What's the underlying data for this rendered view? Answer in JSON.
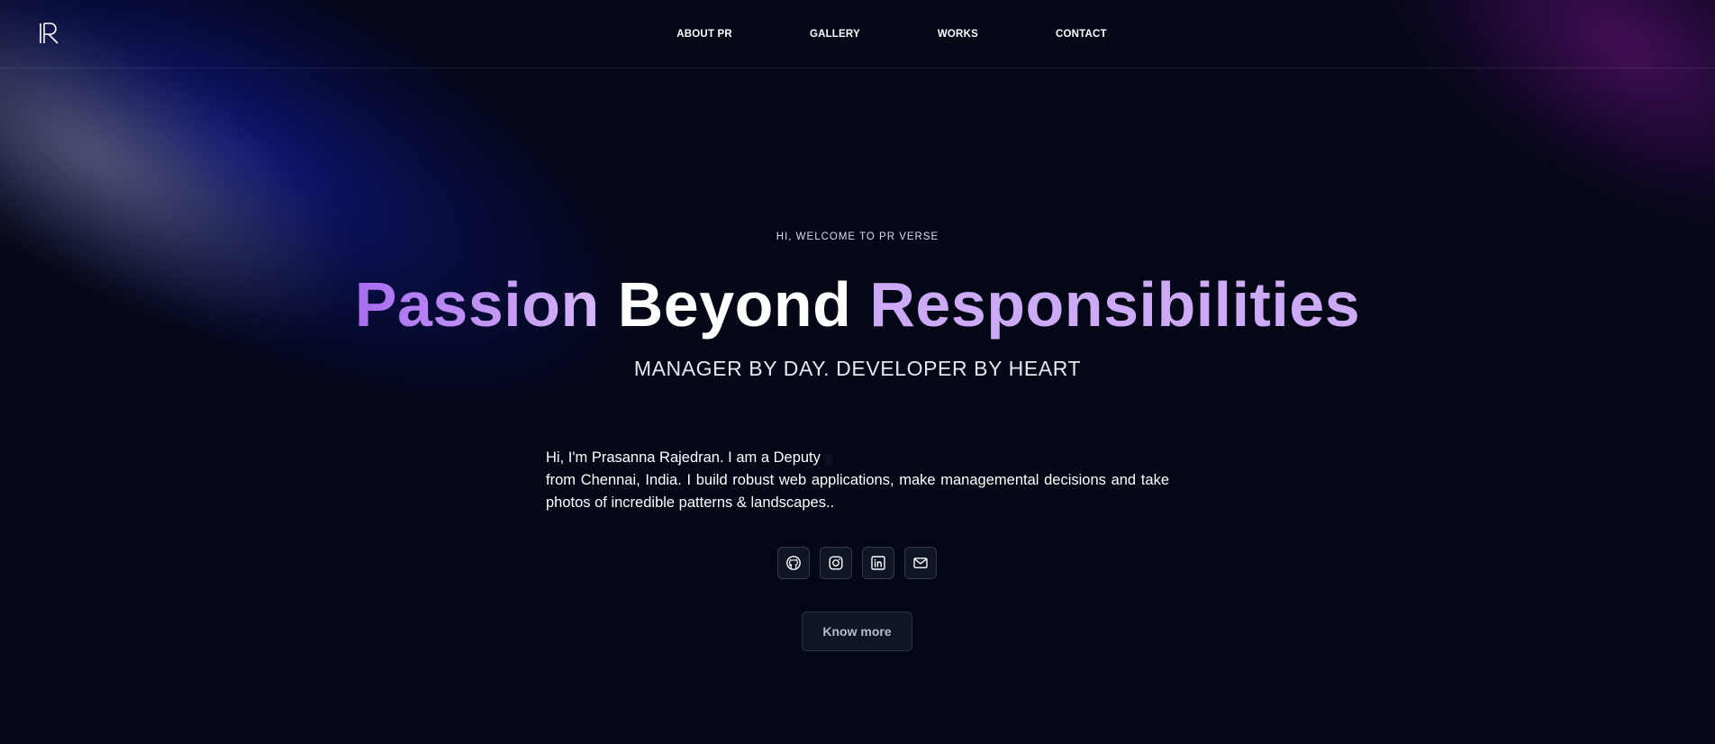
{
  "nav": {
    "logo_alt": "PR",
    "links": [
      "ABOUT PR",
      "GALLERY",
      "WORKS",
      "CONTACT"
    ]
  },
  "hero": {
    "eyebrow": "HI, WELCOME TO PR VERSE",
    "headline": {
      "word1": "Passion",
      "word2": "Beyond",
      "word3": "Responsibilities"
    },
    "subheadline": "MANAGER BY DAY. DEVELOPER BY HEART",
    "bio": {
      "prefix": "Hi, I'm Prasanna Rajedran. I am a",
      "role_visible": "Deputy",
      "role_fading": "g",
      "rest": "from Chennai, India. I build robust web applications, make managemental decisions and take photos of incredible patterns & landscapes.."
    },
    "socials": [
      {
        "name": "github-icon"
      },
      {
        "name": "instagram-icon"
      },
      {
        "name": "linkedin-icon"
      },
      {
        "name": "mail-icon"
      }
    ],
    "cta_label": "Know more"
  },
  "colors": {
    "background": "#040716",
    "accent_purple": "#cdaaf6",
    "accent_purple_deep": "#a86cf0",
    "button_bg": "#0f1524"
  }
}
